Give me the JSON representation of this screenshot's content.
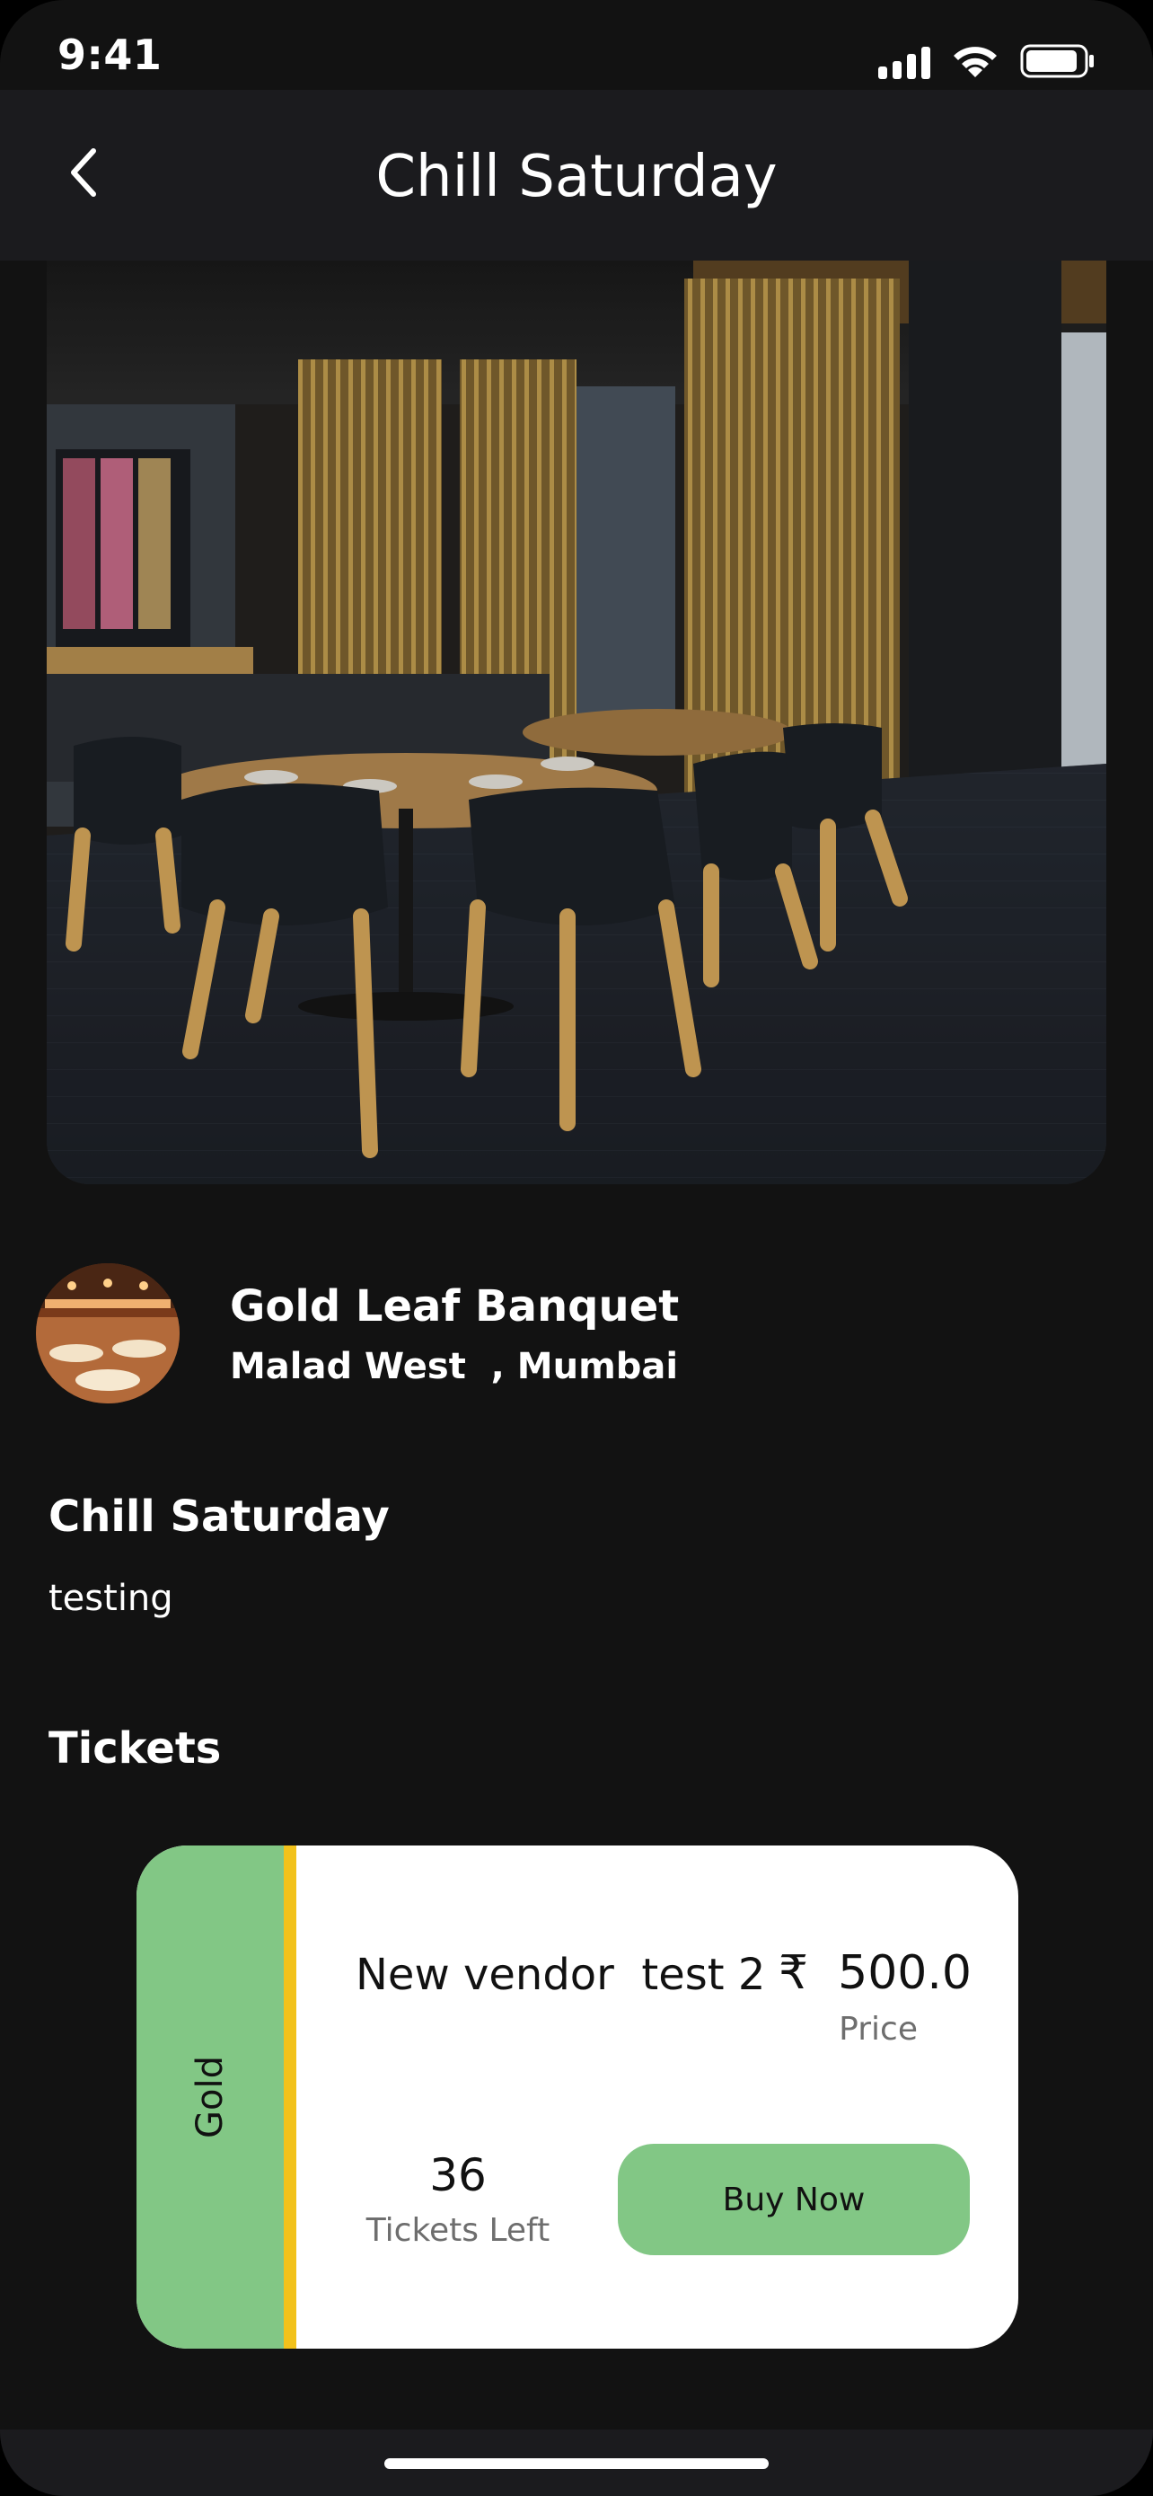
{
  "status_bar": {
    "time": "9:41"
  },
  "header": {
    "title": "Chill Saturday",
    "back_icon": "chevron-left-icon"
  },
  "venue": {
    "name": "Gold Leaf Banquet",
    "location": "Malad West  , Mumbai"
  },
  "event": {
    "title": "Chill Saturday",
    "description": "testing"
  },
  "tickets": {
    "heading": "Tickets",
    "items": [
      {
        "tier": "Gold",
        "name": "New vendor  test 2",
        "price": "₹  500.0",
        "price_label": "Price",
        "count": "36",
        "count_label": "Tickets Left",
        "buy_label": "Buy Now"
      }
    ]
  },
  "colors": {
    "background": "#121212",
    "nav_background": "#1b1b1e",
    "accent_green": "#82c785",
    "accent_yellow": "#f2c21b"
  }
}
